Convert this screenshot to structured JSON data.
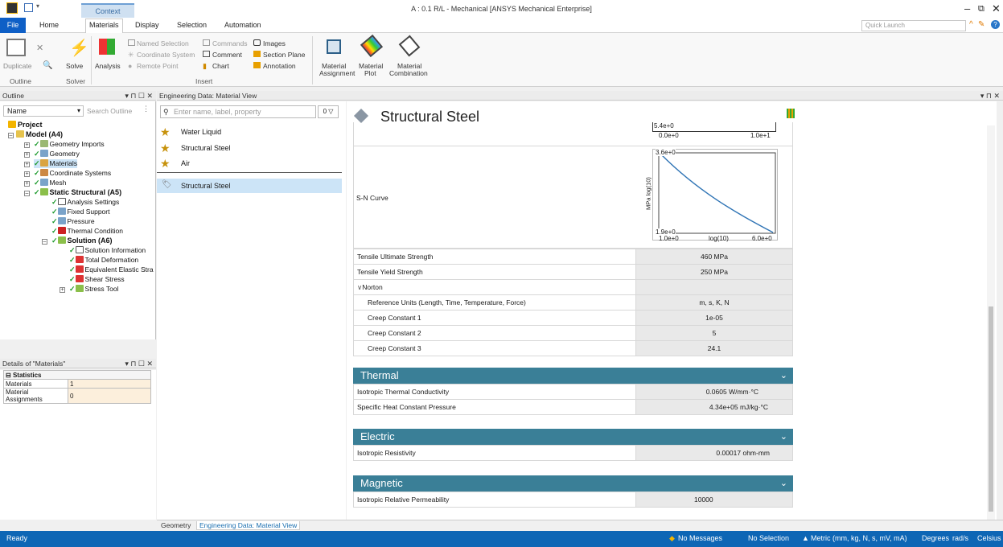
{
  "window": {
    "title": "A : 0.1 R/L - Mechanical [ANSYS Mechanical Enterprise]",
    "context_tab": "Context",
    "controls": [
      "–",
      "🗗",
      "✕"
    ]
  },
  "tabs": {
    "file": "File",
    "items": [
      "Home",
      "Materials",
      "Display",
      "Selection",
      "Automation"
    ],
    "active": "Materials",
    "quick_launch": "Quick Launch"
  },
  "ribbon": {
    "duplicate": "Duplicate",
    "outline_group": "Outline",
    "solve": "Solve",
    "solver_group": "Solver",
    "analysis": "Analysis",
    "insert_group": "Insert",
    "named_selection": "Named Selection",
    "coordinate_system": "Coordinate System",
    "remote_point": "Remote Point",
    "commands": "Commands",
    "comment": "Comment",
    "chart": "Chart",
    "images": "Images",
    "section_plane": "Section Plane",
    "annotation": "Annotation",
    "material_assignment_1": "Material",
    "material_assignment_2": "Assignment",
    "material_plot_1": "Material",
    "material_plot_2": "Plot",
    "material_combination_1": "Material",
    "material_combination_2": "Combination"
  },
  "outline": {
    "header": "Outline",
    "name_label": "Name",
    "search_placeholder": "Search Outline",
    "nodes": [
      {
        "label": "Project"
      },
      {
        "label": "Model (A4)"
      },
      {
        "label": "Geometry Imports"
      },
      {
        "label": "Geometry"
      },
      {
        "label": "Materials"
      },
      {
        "label": "Coordinate Systems"
      },
      {
        "label": "Mesh"
      },
      {
        "label": "Static Structural (A5)"
      },
      {
        "label": "Analysis Settings"
      },
      {
        "label": "Fixed Support"
      },
      {
        "label": "Pressure"
      },
      {
        "label": "Thermal Condition"
      },
      {
        "label": "Solution (A6)"
      },
      {
        "label": "Solution Information"
      },
      {
        "label": "Total Deformation"
      },
      {
        "label": "Equivalent Elastic Stra"
      },
      {
        "label": "Shear Stress"
      },
      {
        "label": "Stress Tool"
      }
    ]
  },
  "details": {
    "header": "Details of \"Materials\"",
    "section": "Statistics",
    "rows": [
      {
        "label": "Materials",
        "value": "1"
      },
      {
        "label": "Material Assignments",
        "value": "0"
      }
    ]
  },
  "material_panel": {
    "header": "Engineering Data: Material View",
    "search_placeholder": "Enter name, label, property",
    "filter_count": "0",
    "library": [
      "Water Liquid",
      "Structural Steel",
      "Air"
    ],
    "selected": "Structural Steel"
  },
  "material": {
    "name": "Structural Steel",
    "top_chart": {
      "y_label": "5.4e+0",
      "x_min": "0.0e+0",
      "x_max": "1.0e+1"
    },
    "sn_curve": {
      "label": "S-N Curve",
      "y_max": "3.6e+0",
      "y_min": "1.9e+0",
      "y_axis": "MPa log(10)",
      "x_min": "1.0e+0",
      "x_axis": "log(10)",
      "x_max": "6.0e+0"
    },
    "properties": [
      {
        "label": "Tensile Ultimate Strength",
        "value": "460  MPa"
      },
      {
        "label": "Tensile Yield Strength",
        "value": "250  MPa"
      }
    ],
    "norton": {
      "label": "Norton",
      "rows": [
        {
          "label": "Reference Units (Length, Time, Temperature, Force)",
          "value": "m, s, K, N"
        },
        {
          "label": "Creep Constant 1",
          "value": "1e-05"
        },
        {
          "label": "Creep Constant 2",
          "value": "5"
        },
        {
          "label": "Creep Constant 3",
          "value": "24.1"
        }
      ]
    },
    "sections": [
      {
        "title": "Thermal",
        "rows": [
          {
            "label": "Isotropic Thermal Conductivity",
            "value": "0.0605  W/mm·°C"
          },
          {
            "label": "Specific Heat Constant Pressure",
            "value": "4.34e+05  mJ/kg·°C"
          }
        ]
      },
      {
        "title": "Electric",
        "rows": [
          {
            "label": "Isotropic Resistivity",
            "value": "0.00017  ohm-mm"
          }
        ]
      },
      {
        "title": "Magnetic",
        "rows": [
          {
            "label": "Isotropic Relative Permeability",
            "value": "10000"
          }
        ]
      }
    ]
  },
  "bottom_tabs": [
    "Geometry",
    "Engineering Data: Material View"
  ],
  "status": {
    "ready": "Ready",
    "messages": "No Messages",
    "selection": "No Selection",
    "units": "Metric (mm, kg, N, s, mV, mA)",
    "angle": "Degrees",
    "rot": "rad/s",
    "temp": "Celsius"
  },
  "colors": {
    "accent": "#0e66b5",
    "section_header": "#3a7f97",
    "selection": "#cce4f7"
  }
}
